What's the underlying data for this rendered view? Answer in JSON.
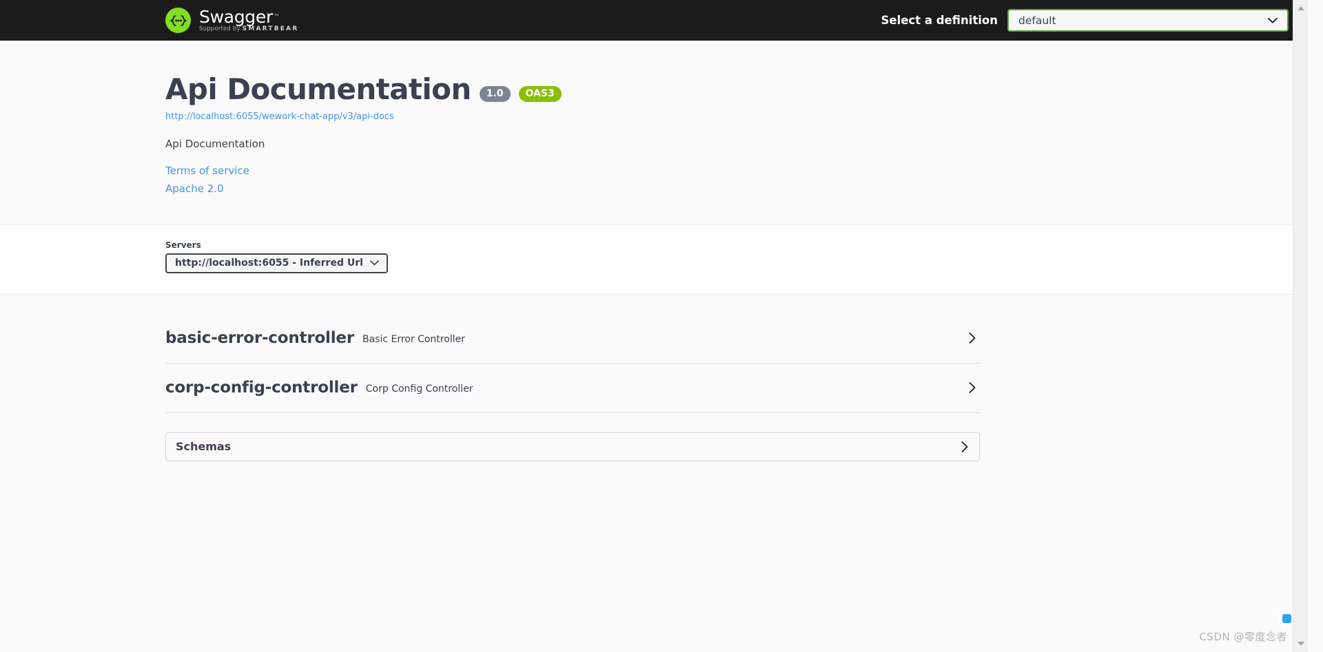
{
  "topbar": {
    "brand_name": "Swagger",
    "brand_tm": "™",
    "brand_supported_prefix": "Supported by",
    "brand_supported_company": "SMARTBEAR",
    "logo_icon": "swagger-braces-icon",
    "definition_label": "Select a definition",
    "definition_value": "default",
    "definition_chevron_icon": "chevron-down-icon",
    "background_color": "#1b1b1b",
    "select_border_color": "#62a03f"
  },
  "info": {
    "title": "Api Documentation",
    "version_badge": "1.0",
    "spec_badge": "OAS3",
    "version_badge_color": "#7d8492",
    "spec_badge_color": "#89bf04",
    "docs_url": "http://localhost:6055/wework-chat-app/v3/api-docs",
    "description": "Api Documentation",
    "links": [
      {
        "label": "Terms of service"
      },
      {
        "label": "Apache 2.0"
      }
    ],
    "link_color": "#4990e2"
  },
  "servers": {
    "label": "Servers",
    "selected": "http://localhost:6055 - Inferred Url",
    "chevron_icon": "chevron-down-icon"
  },
  "operations": {
    "tags": [
      {
        "name": "basic-error-controller",
        "description": "Basic Error Controller",
        "expand_icon": "chevron-right-icon"
      },
      {
        "name": "corp-config-controller",
        "description": "Corp Config Controller",
        "expand_icon": "chevron-right-icon"
      }
    ]
  },
  "schemas": {
    "title": "Schemas",
    "expand_icon": "chevron-right-icon"
  },
  "scrollbar": {
    "up_icon": "scroll-up-arrow-icon",
    "down_icon": "scroll-down-arrow-icon"
  },
  "watermark": {
    "text": "CSDN @零度念者"
  }
}
